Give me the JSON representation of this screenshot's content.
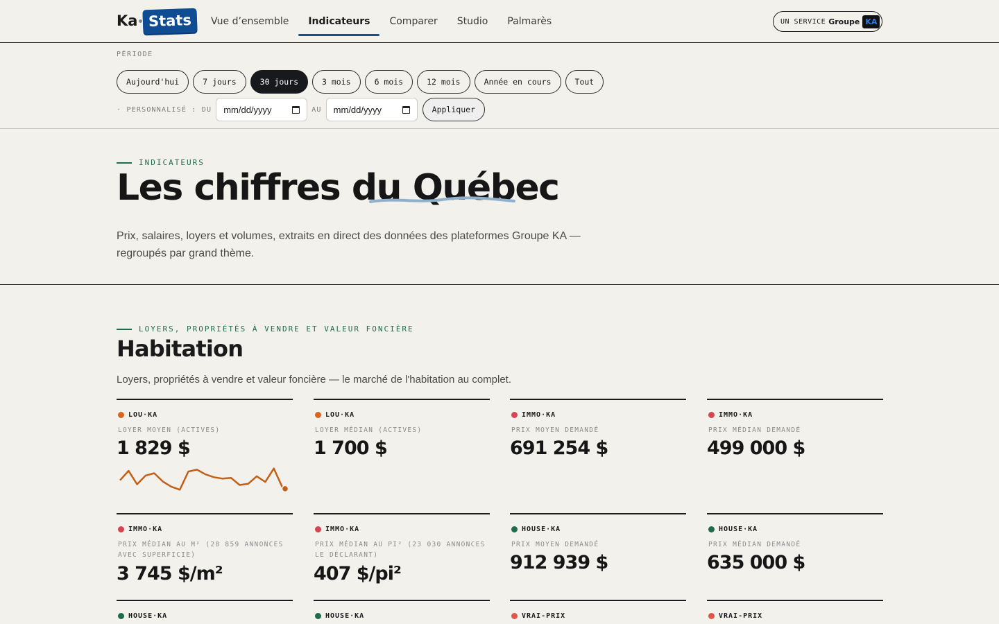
{
  "header": {
    "logo_ka": "Ka",
    "logo_stats": "Stats",
    "nav": [
      {
        "label": "Vue d’ensemble",
        "active": false
      },
      {
        "label": "Indicateurs",
        "active": true
      },
      {
        "label": "Comparer",
        "active": false
      },
      {
        "label": "Studio",
        "active": false
      },
      {
        "label": "Palmarès",
        "active": false
      }
    ],
    "service": {
      "prefix": "UN SERVICE",
      "groupe": "Groupe",
      "ka": "KA"
    }
  },
  "period": {
    "label": "PÉRIODE",
    "chips": [
      {
        "label": "Aujourd'hui",
        "active": false
      },
      {
        "label": "7 jours",
        "active": false
      },
      {
        "label": "30 jours",
        "active": true
      },
      {
        "label": "3 mois",
        "active": false
      },
      {
        "label": "6 mois",
        "active": false
      },
      {
        "label": "12 mois",
        "active": false
      },
      {
        "label": "Année en cours",
        "active": false
      },
      {
        "label": "Tout",
        "active": false
      }
    ],
    "custom_label": "· PERSONNALISÉ : DU",
    "from_placeholder": "mm/dd/yyyy",
    "to_label": "AU",
    "to_placeholder": "mm/dd/yyyy",
    "apply_label": "Appliquer"
  },
  "hero": {
    "eyebrow": "INDICATEURS",
    "title_start": "Les chiffres du ",
    "title_highlight": "Québec",
    "description": "Prix, salaires, loyers et volumes, extraits en direct des données des plateformes Groupe KA — regroupés par grand thème."
  },
  "section": {
    "eyebrow": "LOYERS, PROPRIÉTÉS À VENDRE ET VALEUR FONCIÈRE",
    "title": "Habitation",
    "description": "Loyers, propriétés à vendre et valeur foncière — le marché de l'habitation au complet."
  },
  "colors": {
    "louka": "#d9661e",
    "immoka": "#d64550",
    "houseka": "#1f6b4a",
    "vraiprix": "#e0574a",
    "spark": "#c25e17"
  },
  "cards": [
    {
      "source": "LOU·KA",
      "label": "LOYER MOYEN (ACTIVES)",
      "value": "1 829 $",
      "dot": "#d9661e"
    },
    {
      "source": "LOU·KA",
      "label": "LOYER MÉDIAN (ACTIVES)",
      "value": "1 700 $",
      "dot": "#d9661e"
    },
    {
      "source": "IMMO·KA",
      "label": "PRIX MOYEN DEMANDÉ",
      "value": "691 254 $",
      "dot": "#d64550"
    },
    {
      "source": "IMMO·KA",
      "label": "PRIX MÉDIAN DEMANDÉ",
      "value": "499 000 $",
      "dot": "#d64550"
    },
    {
      "source": "IMMO·KA",
      "label": "PRIX MÉDIAN AU M² (28 859 ANNONCES AVEC SUPERFICIE)",
      "value": "3 745 $/m²",
      "dot": "#d64550"
    },
    {
      "source": "IMMO·KA",
      "label": "PRIX MÉDIAN AU PI² (23 030 ANNONCES LE DÉCLARANT)",
      "value": "407 $/pi²",
      "dot": "#d64550"
    },
    {
      "source": "HOUSE·KA",
      "label": "PRIX MOYEN DEMANDÉ",
      "value": "912 939 $",
      "dot": "#1f6b4a"
    },
    {
      "source": "HOUSE·KA",
      "label": "PRIX MÉDIAN DEMANDÉ",
      "value": "635 000 $",
      "dot": "#1f6b4a"
    },
    {
      "source": "HOUSE·KA",
      "label": "",
      "value": "",
      "dot": "#1f6b4a"
    },
    {
      "source": "HOUSE·KA",
      "label": "",
      "value": "",
      "dot": "#1f6b4a"
    },
    {
      "source": "VRAI-PRIX",
      "label": "",
      "value": "",
      "dot": "#e0574a"
    },
    {
      "source": "VRAI-PRIX",
      "label": "",
      "value": "",
      "dot": "#e0574a"
    }
  ],
  "sparkline": [
    0.55,
    0.15,
    0.72,
    0.35,
    0.25,
    0.6,
    0.82,
    0.95,
    0.18,
    0.1,
    0.3,
    0.42,
    0.48,
    0.45,
    0.75,
    0.7,
    0.38,
    0.62,
    0.05,
    0.85
  ]
}
